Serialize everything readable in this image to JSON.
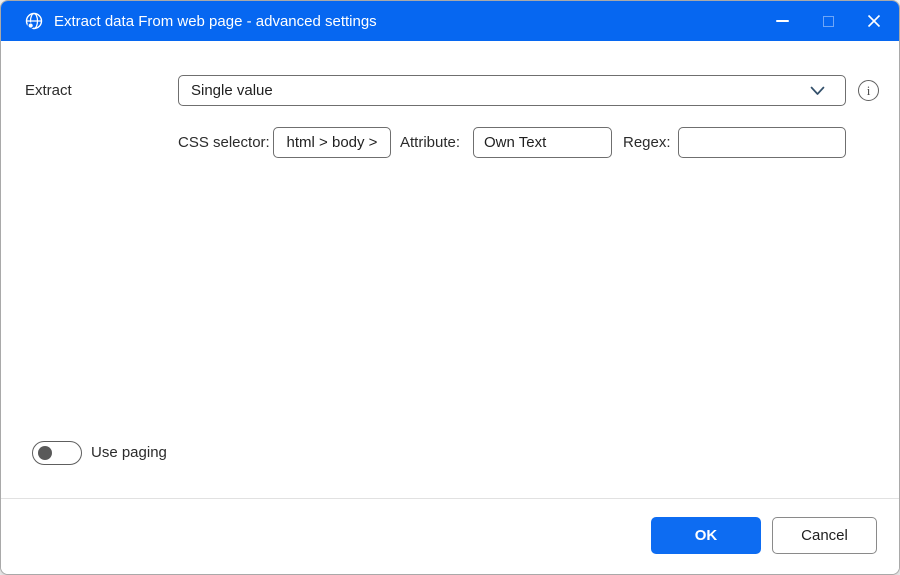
{
  "window": {
    "title": "Extract data From web page - advanced settings"
  },
  "form": {
    "extract_label": "Extract",
    "extract_selected_value": "Single value",
    "css_selector_label": "CSS selector:",
    "css_selector_value": "html > body >",
    "attribute_label": "Attribute:",
    "attribute_value": "Own Text",
    "regex_label": "Regex:",
    "regex_value": "",
    "use_paging_label": "Use paging",
    "use_paging_state": "off",
    "info_icon_glyph": "i"
  },
  "footer": {
    "ok_label": "OK",
    "cancel_label": "Cancel"
  },
  "icons": {
    "app_icon": "globe-with-dot",
    "combobox_chevron": "chevron-down",
    "minimize": "minimize",
    "maximize": "maximize",
    "close": "close"
  },
  "colors": {
    "titlebar_background": "#0667f1",
    "ok_button_background": "#0d6cf2",
    "input_border": "#6f6f6f",
    "toggle_knob": "#595959",
    "text": "#2b2b2b"
  }
}
